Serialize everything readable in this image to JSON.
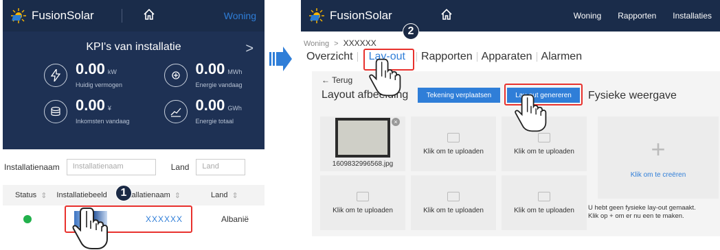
{
  "left": {
    "brand": "FusionSolar",
    "tab": "Woning",
    "kpi": {
      "title": "KPI's van installatie",
      "items": [
        {
          "value": "0.00",
          "unit": "kW",
          "label": "Huidig vermogen"
        },
        {
          "value": "0.00",
          "unit": "MWh",
          "label": "Energie vandaag"
        },
        {
          "value": "0.00",
          "unit": "¥",
          "label": "Inkomsten vandaag"
        },
        {
          "value": "0.00",
          "unit": "GWh",
          "label": "Energie totaal"
        }
      ]
    },
    "search": {
      "name_label": "Installatienaam",
      "name_placeholder": "Installatienaam",
      "country_label": "Land",
      "country_placeholder": "Land"
    },
    "table": {
      "headers": [
        "Status",
        "Installatiebeeld",
        "Installatienaam",
        "Land"
      ],
      "row": {
        "name": "XXXXXX",
        "country": "Albanië"
      }
    },
    "step": "1"
  },
  "right": {
    "brand": "FusionSolar",
    "nav": [
      "Woning",
      "Rapporten",
      "Installaties"
    ],
    "breadcrumb": {
      "home": "Woning",
      "sep": ">",
      "current": "XXXXXX"
    },
    "tabs": [
      "Overzicht",
      "Lay-out",
      "Rapporten",
      "Apparaten",
      "Alarmen"
    ],
    "back": "← Terug",
    "layout_title": "Layout afbeelding",
    "btn_move": "Tekening verplaatsen",
    "btn_generate": "Lay-out genereren",
    "physical_title": "Fysieke weergave",
    "thumb_name": "1609832996568.jpg",
    "upload_label": "Klik om te uploaden",
    "create_label": "Klik om te creëren",
    "empty_text_1": "U hebt geen fysieke lay-out gemaakt.",
    "empty_text_2": "Klik op + om er nu een te maken.",
    "step": "2"
  },
  "colors": {
    "header": "#1a2c4a",
    "kpi_bg": "#1e3154",
    "accent": "#2f7ed8",
    "highlight": "#e8302c",
    "status_ok": "#22b14c"
  }
}
